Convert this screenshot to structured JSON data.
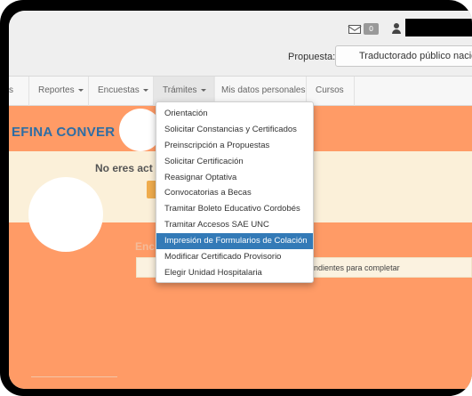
{
  "header": {
    "messages_count": "0",
    "propuesta_label": "Propuesta:",
    "propuesta_value": "Traductorado público nacion"
  },
  "nav": {
    "items": [
      {
        "label": "s"
      },
      {
        "label": "Reportes"
      },
      {
        "label": "Encuestas"
      },
      {
        "label": "Trámites"
      },
      {
        "label": "Mis datos personales"
      },
      {
        "label": "Cursos"
      }
    ]
  },
  "main": {
    "title": "EFINA CONVER",
    "alert_text": "No eres act",
    "section_heading": "Enc",
    "notice_text": "s pendientes para completar"
  },
  "tramites_menu": {
    "items": [
      {
        "label": "Orientación"
      },
      {
        "label": "Solicitar Constancias y Certificados"
      },
      {
        "label": "Preinscripción a Propuestas"
      },
      {
        "label": "Solicitar Certificación"
      },
      {
        "label": "Reasignar Optativa"
      },
      {
        "label": "Convocatorias a Becas"
      },
      {
        "label": "Tramitar Boleto Educativo Cordobés"
      },
      {
        "label": "Tramitar Accesos SAE UNC"
      },
      {
        "label": "Impresión de Formularios de Colación"
      },
      {
        "label": "Modificar Certificado Provisorio"
      },
      {
        "label": "Elegir Unidad Hospitalaria"
      }
    ],
    "highlighted_index": 8
  },
  "colors": {
    "main_background": "#ff9b66",
    "alert_background": "#fbf0d9",
    "title": "#2e6da4",
    "menu_highlight": "#337ab7"
  },
  "icons": [
    "mail-icon",
    "user-icon",
    "caret-down-icon"
  ]
}
